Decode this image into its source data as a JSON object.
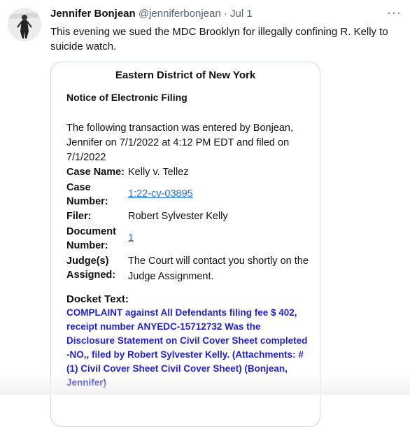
{
  "tweet": {
    "author_name": "Jennifer Bonjean",
    "handle": "@jenniferbonjean",
    "separator": "·",
    "date": "Jul 1",
    "text": "This evening we sued the MDC Brooklyn for illegally confining R. Kelly to suicide watch.",
    "more_icon": "more-horizontal-icon"
  },
  "card": {
    "court": "Eastern District of New York",
    "heading": "Notice of Electronic Filing",
    "intro": "The following transaction was entered by Bonjean, Jennifer on 7/1/2022 at 4:12 PM EDT and filed on 7/1/2022",
    "fields": {
      "case_name_label": "Case Name:",
      "case_name": "Kelly v. Tellez",
      "case_number_label_1": "Case",
      "case_number_label_2": "Number:",
      "case_number": "1:22-cv-03895",
      "filer_label": "Filer:",
      "filer": "Robert Sylvester Kelly",
      "document_number_label_1": "Document",
      "document_number_label_2": "Number:",
      "document_number": "1",
      "judge_label_1": "Judge(s)",
      "judge_label_2": "Assigned:",
      "judge": "The Court will contact you shortly on the Judge Assignment."
    },
    "docket_title": "Docket Text:",
    "docket_text": "COMPLAINT against All Defendants filing fee $ 402, receipt number ANYEDC-15712732 Was the Disclosure Statement on Civil Cover Sheet completed -NO,, filed by Robert Sylvester Kelly. (Attachments: # (1) Civil Cover Sheet Civil Cover Sheet) (Bonjean, Jennifer)"
  }
}
